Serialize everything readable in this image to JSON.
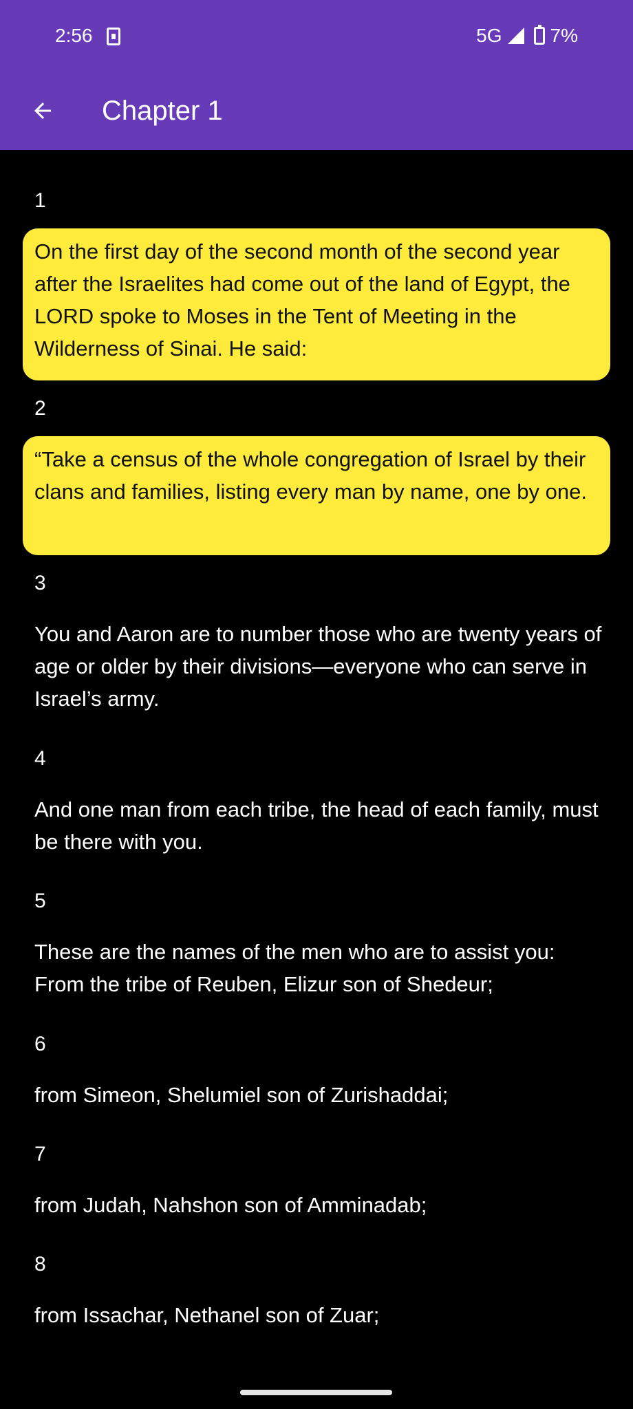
{
  "status_bar": {
    "time": "2:56",
    "network": "5G",
    "battery": "7%"
  },
  "app_bar": {
    "title": "Chapter 1",
    "back_icon": "arrow-left-icon"
  },
  "verses": [
    {
      "number": "1",
      "text": "On the first day of the second month of the second year after the Israelites had come out of the land of Egypt, the LORD spoke to Moses in the Tent of Meeting in the Wilderness of Sinai. He said:",
      "highlighted": true
    },
    {
      "number": "2",
      "text": "“Take a census of the whole congregation of Israel by their clans and families, listing every man by name, one by one.",
      "highlighted": true
    },
    {
      "number": "3",
      "text": "You and Aaron are to number those who are twenty years of age or older by their divisions—everyone who can serve in Israel’s army.",
      "highlighted": false
    },
    {
      "number": "4",
      "text": "And one man from each tribe, the head of each family, must be there with you.",
      "highlighted": false
    },
    {
      "number": "5",
      "text": "These are the names of the men who are to assist you: From the tribe of Reuben, Elizur son of Shedeur;",
      "highlighted": false
    },
    {
      "number": "6",
      "text": "from Simeon, Shelumiel son of Zurishaddai;",
      "highlighted": false
    },
    {
      "number": "7",
      "text": "from Judah, Nahshon son of Amminadab;",
      "highlighted": false
    },
    {
      "number": "8",
      "text": "from Issachar, Nethanel son of Zuar;",
      "highlighted": false
    }
  ],
  "colors": {
    "app_bar": "#673ab7",
    "highlight": "#ffeb3b",
    "background": "#000000"
  }
}
